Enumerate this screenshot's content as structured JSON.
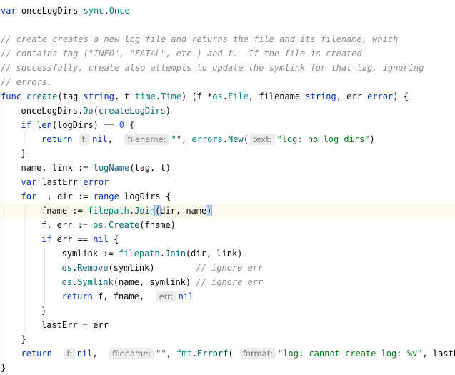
{
  "lines": [
    [
      {
        "c": "kw",
        "t": "var"
      },
      {
        "t": " onceLogDirs "
      },
      {
        "c": "pkg",
        "t": "sync"
      },
      {
        "t": "."
      },
      {
        "c": "pkg",
        "t": "Once"
      }
    ],
    [],
    [
      {
        "c": "cmt",
        "t": "// create creates a new log file and returns the file and its filename, which"
      }
    ],
    [
      {
        "c": "cmt",
        "t": "// contains tag (\"INFO\", \"FATAL\", etc.) and t.  If the file is created"
      }
    ],
    [
      {
        "c": "cmt",
        "t": "// successfully, create also attempts to update the symlink for that tag, ignoring"
      }
    ],
    [
      {
        "c": "cmt",
        "t": "// errors."
      }
    ],
    [
      {
        "c": "kw",
        "t": "func"
      },
      {
        "t": " "
      },
      {
        "c": "fn",
        "t": "create"
      },
      {
        "t": "(tag "
      },
      {
        "c": "kw",
        "t": "string"
      },
      {
        "t": ", t "
      },
      {
        "c": "pkg",
        "t": "time"
      },
      {
        "t": "."
      },
      {
        "c": "pkg",
        "t": "Time"
      },
      {
        "t": ") (f *"
      },
      {
        "c": "pkg",
        "t": "os"
      },
      {
        "t": "."
      },
      {
        "c": "pkg",
        "t": "File"
      },
      {
        "t": ", filename "
      },
      {
        "c": "kw",
        "t": "string"
      },
      {
        "t": ", err "
      },
      {
        "c": "kw",
        "t": "error"
      },
      {
        "t": ") {"
      }
    ],
    [
      {
        "t": "onceLogDirs."
      },
      {
        "c": "pkg-call",
        "t": "Do"
      },
      {
        "t": "("
      },
      {
        "c": "fn",
        "t": "createLogDirs"
      },
      {
        "t": ")"
      }
    ],
    [
      {
        "c": "kw",
        "t": "if"
      },
      {
        "t": " "
      },
      {
        "c": "kw",
        "t": "len"
      },
      {
        "t": "(logDirs) == "
      },
      {
        "c": "num",
        "t": "0"
      },
      {
        "t": " {"
      }
    ],
    [
      {
        "c": "kw",
        "t": "return"
      },
      {
        "t": " "
      },
      {
        "h": "f:"
      },
      {
        "c": "kw",
        "t": "nil"
      },
      {
        "t": ",  "
      },
      {
        "h": "filename:"
      },
      {
        "c": "str",
        "t": "\"\""
      },
      {
        "t": ", "
      },
      {
        "c": "pkg",
        "t": "errors"
      },
      {
        "t": "."
      },
      {
        "c": "pkg-call",
        "t": "New"
      },
      {
        "t": "("
      },
      {
        "h": "text:"
      },
      {
        "c": "str",
        "t": "\"log: no log dirs\""
      },
      {
        "t": ")"
      }
    ],
    [
      {
        "t": "}"
      }
    ],
    [
      {
        "t": "name, link := "
      },
      {
        "c": "fn",
        "t": "logName"
      },
      {
        "t": "(tag, t)"
      }
    ],
    [
      {
        "c": "kw",
        "t": "var"
      },
      {
        "t": " lastErr "
      },
      {
        "c": "kw",
        "t": "error"
      }
    ],
    [
      {
        "c": "kw",
        "t": "for"
      },
      {
        "t": " _, dir := "
      },
      {
        "c": "kw",
        "t": "range"
      },
      {
        "t": " logDirs {"
      }
    ],
    [
      {
        "t": "fname := "
      },
      {
        "c": "pkg",
        "t": "filepath"
      },
      {
        "t": "."
      },
      {
        "c": "pkg-call",
        "t": "Join"
      },
      {
        "b": "("
      },
      {
        "t": "dir, name"
      },
      {
        "b": ")"
      },
      {
        "caret": true
      }
    ],
    [
      {
        "t": "f, err := "
      },
      {
        "c": "pkg",
        "t": "os"
      },
      {
        "t": "."
      },
      {
        "c": "pkg-call",
        "t": "Create"
      },
      {
        "t": "(fname)"
      }
    ],
    [
      {
        "c": "kw",
        "t": "if"
      },
      {
        "t": " err == "
      },
      {
        "c": "kw",
        "t": "nil"
      },
      {
        "t": " {"
      }
    ],
    [
      {
        "t": "symlink := "
      },
      {
        "c": "pkg",
        "t": "filepath"
      },
      {
        "t": "."
      },
      {
        "c": "pkg-call",
        "t": "Join"
      },
      {
        "t": "(dir, link)"
      }
    ],
    [
      {
        "c": "pkg",
        "t": "os"
      },
      {
        "t": "."
      },
      {
        "c": "pkg-call",
        "t": "Remove"
      },
      {
        "t": "(symlink)        "
      },
      {
        "c": "cmt",
        "t": "// ignore err"
      }
    ],
    [
      {
        "c": "pkg",
        "t": "os"
      },
      {
        "t": "."
      },
      {
        "c": "pkg-call",
        "t": "Symlink"
      },
      {
        "t": "(name, symlink) "
      },
      {
        "c": "cmt",
        "t": "// ignore err"
      }
    ],
    [
      {
        "c": "kw",
        "t": "return"
      },
      {
        "t": " f, fname,  "
      },
      {
        "h": "err:"
      },
      {
        "c": "kw",
        "t": "nil"
      }
    ],
    [
      {
        "t": "}"
      }
    ],
    [
      {
        "t": "lastErr = err"
      }
    ],
    [
      {
        "t": "}"
      }
    ],
    [
      {
        "c": "kw",
        "t": "return"
      },
      {
        "t": "  "
      },
      {
        "h": "f:"
      },
      {
        "c": "kw",
        "t": "nil"
      },
      {
        "t": ",  "
      },
      {
        "h": "filename:"
      },
      {
        "c": "str",
        "t": "\"\""
      },
      {
        "t": ", "
      },
      {
        "c": "pkg",
        "t": "fmt"
      },
      {
        "t": "."
      },
      {
        "c": "pkg-call",
        "t": "Errorf"
      },
      {
        "t": "( "
      },
      {
        "h": "format:"
      },
      {
        "c": "str",
        "t": "\"log: cannot create log: %v\""
      },
      {
        "t": ", lastErr)"
      }
    ],
    [
      {
        "t": "}"
      }
    ]
  ]
}
